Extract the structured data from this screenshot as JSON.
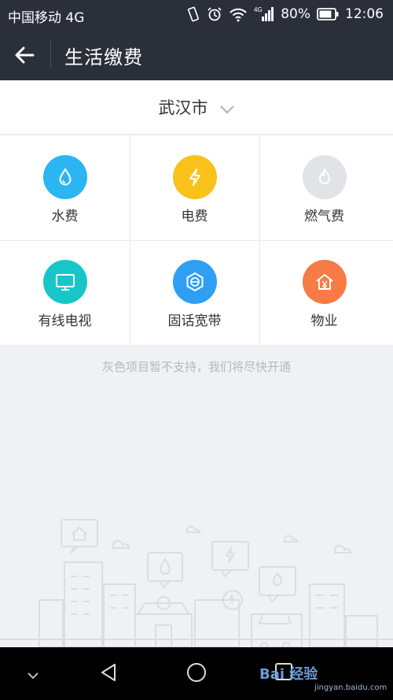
{
  "status_bar": {
    "carrier": "中国移动 4G",
    "network_label": "4G",
    "battery": "80%",
    "time": "12:06"
  },
  "app_bar": {
    "title": "生活缴费",
    "back_icon": "arrow-left-icon"
  },
  "city_selector": {
    "city": "武汉市",
    "icon": "chevron-down-icon"
  },
  "services": [
    {
      "label": "水费",
      "icon": "water-drop-icon",
      "color": "#2bb6f2",
      "supported": true
    },
    {
      "label": "电费",
      "icon": "lightning-icon",
      "color": "#f9c21b",
      "supported": true
    },
    {
      "label": "燃气费",
      "icon": "flame-icon",
      "color": "#e2e3e6",
      "supported": false
    },
    {
      "label": "有线电视",
      "icon": "tv-icon",
      "color": "#18c6c9",
      "supported": true
    },
    {
      "label": "固话宽带",
      "icon": "broadband-icon",
      "color": "#2f9ff3",
      "supported": true
    },
    {
      "label": "物业",
      "icon": "house-yuan-icon",
      "color": "#f77b45",
      "supported": true
    }
  ],
  "notice": "灰色项目暂不支持，我们将尽快开通",
  "watermark": {
    "text": "Bai 经验",
    "url": "jingyan.baidu.com"
  },
  "colors": {
    "header_bg": "#2a2f3a",
    "content_bg": "#f0f1f4",
    "illustration_stroke": "#dcdde2"
  }
}
